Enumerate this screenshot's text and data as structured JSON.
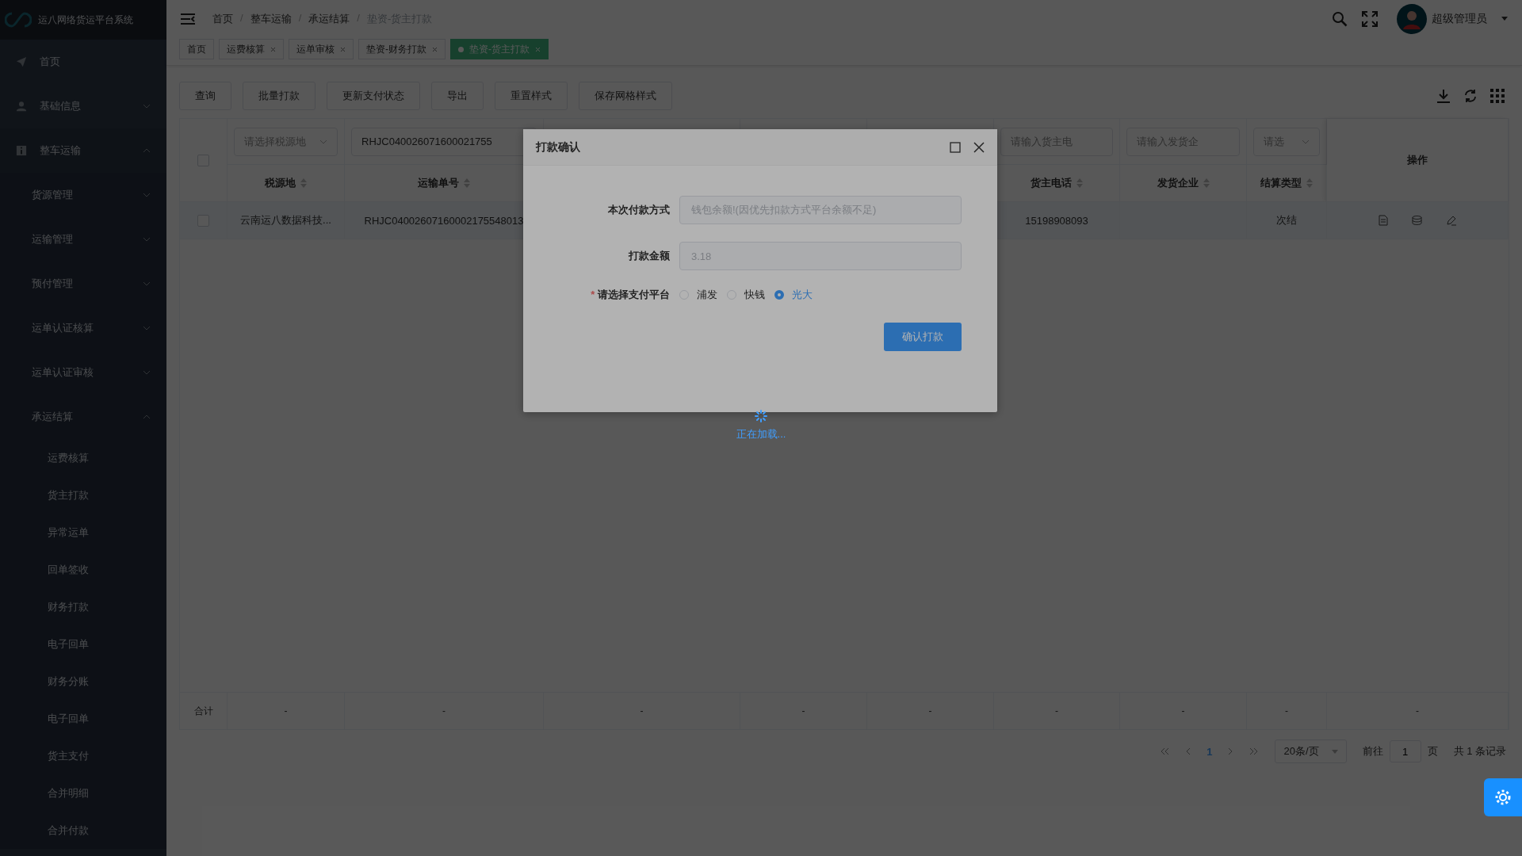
{
  "app": {
    "title": "运八网络货运平台系统"
  },
  "sidebar": {
    "items": [
      {
        "label": "首页"
      },
      {
        "label": "基础信息",
        "expanded": false
      },
      {
        "label": "整车运输",
        "expanded": true,
        "children": [
          {
            "label": "货源管理",
            "expanded": false
          },
          {
            "label": "运输管理",
            "expanded": false
          },
          {
            "label": "预付管理",
            "expanded": false
          },
          {
            "label": "运单认证核算",
            "expanded": false
          },
          {
            "label": "运单认证审核",
            "expanded": false
          },
          {
            "label": "承运结算",
            "expanded": true,
            "children": [
              {
                "label": "运费核算"
              },
              {
                "label": "货主打款"
              },
              {
                "label": "异常运单"
              },
              {
                "label": "回单签收"
              },
              {
                "label": "财务打款"
              },
              {
                "label": "电子回单"
              },
              {
                "label": "财务分账"
              },
              {
                "label": "电子回单"
              },
              {
                "label": "货主支付"
              },
              {
                "label": "合并明细"
              },
              {
                "label": "合并付款"
              }
            ]
          }
        ]
      }
    ]
  },
  "header": {
    "breadcrumb": [
      "首页",
      "整车运输",
      "承运结算",
      "垫资-货主打款"
    ],
    "separator": "/",
    "user": "超级管理员"
  },
  "tabs": [
    {
      "label": "首页",
      "closable": false,
      "selected": false
    },
    {
      "label": "运费核算",
      "closable": true,
      "selected": false
    },
    {
      "label": "运单审核",
      "closable": true,
      "selected": false
    },
    {
      "label": "垫资-财务打款",
      "closable": true,
      "selected": false
    },
    {
      "label": "垫资-货主打款",
      "closable": true,
      "selected": true
    }
  ],
  "toolbar": {
    "buttons": [
      "查询",
      "批量打款",
      "更新支付状态",
      "导出",
      "重置样式",
      "保存网格样式"
    ]
  },
  "table": {
    "all_selected": false,
    "columns_left": [
      {
        "label": "税源地",
        "filter": {
          "kind": "select",
          "placeholder": "请选择税源地"
        }
      },
      {
        "label": "运输单号",
        "filter": {
          "kind": "input",
          "value": "RHJC040026071600021755"
        }
      }
    ],
    "columns_right": [
      {
        "label": "货主电话",
        "filter": {
          "kind": "input",
          "placeholder": "请输入货主电"
        }
      },
      {
        "label": "发货企业",
        "filter": {
          "kind": "input",
          "placeholder": "请输入发货企"
        }
      },
      {
        "label": "结算类型",
        "filter": {
          "kind": "select",
          "placeholder": "请选"
        }
      }
    ],
    "action_column": "操作",
    "rows": [
      {
        "selected": false,
        "tax_source": "云南运八数据科技...",
        "waybill_no": "RHJC04002607160002175548013",
        "shipper_phone": "15198908093",
        "settlement_type": "次结"
      }
    ],
    "summary": {
      "label": "合计",
      "cells": [
        "-",
        "-",
        "-",
        "-",
        "-",
        "-",
        "-",
        "-",
        "-"
      ]
    }
  },
  "pagination": {
    "pages": [
      {
        "label": "1",
        "selected": true
      }
    ],
    "page_size": "20条/页",
    "goto_label": "前往",
    "goto_value": "1",
    "page_suffix": "页",
    "total": "共 1 条记录"
  },
  "dialog": {
    "title": "打款确认",
    "fields": [
      {
        "label": "本次付款方式",
        "value": "钱包余额!(因优先扣款方式平台余额不足)",
        "disabled": true
      },
      {
        "label": "打款金额",
        "value": "3.18",
        "disabled": true
      }
    ],
    "radio_group": {
      "label": "请选择支付平台",
      "required_mark": "*",
      "options": [
        {
          "label": "浦发",
          "selected": false
        },
        {
          "label": "快钱",
          "selected": false
        },
        {
          "label": "光大",
          "selected": true
        }
      ]
    },
    "confirm": "确认打款"
  },
  "loading": {
    "text": "正在加载..."
  }
}
